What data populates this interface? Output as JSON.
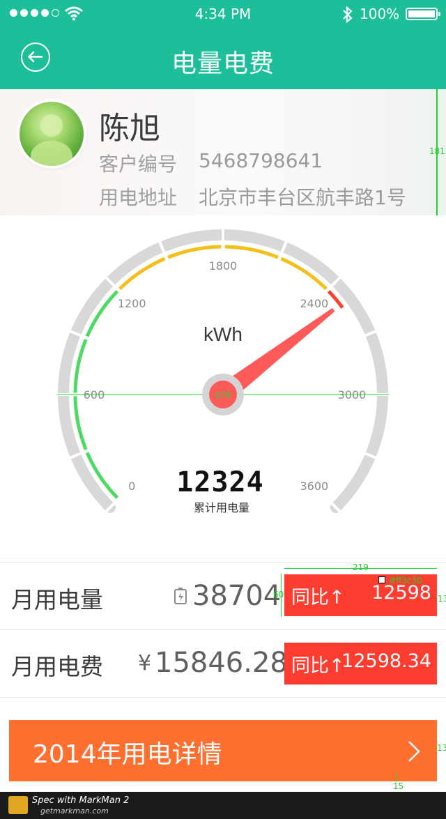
{
  "status_bar": {
    "time": "4:34 PM",
    "battery": "100%"
  },
  "navbar": {
    "title": "电量电费"
  },
  "profile": {
    "name": "陈旭",
    "customer_label": "客户编号",
    "customer_id": "5468798641",
    "address_label": "用电地址",
    "address": "北京市丰台区航丰路1号",
    "ruler_value": "181"
  },
  "gauge": {
    "unit": "kWh",
    "min": 0,
    "max": 3600,
    "major_ticks": [
      "0",
      "600",
      "1200",
      "1800",
      "2400",
      "3000",
      "3600"
    ],
    "needle_value": 2500,
    "center_value": "478",
    "total_value": "12324",
    "total_label": "累计用电量",
    "colors": {
      "green": "#4cd964",
      "yellow": "#f5bf1a",
      "red": "#ff3c30",
      "track": "#d8d8d8",
      "needle": "#ff5a5a"
    }
  },
  "monthly_usage": {
    "label": "月用电量",
    "value": "38704",
    "compare_label": "同比",
    "compare_value": "12598",
    "spec_width": "219",
    "spec_height": "60",
    "spec_color": "#ff3c30",
    "spec_side": "13"
  },
  "monthly_fee": {
    "label": "月用电费",
    "currency": "¥",
    "value": "15846.28",
    "compare_label": "同比",
    "compare_value": "12598.34"
  },
  "cta": {
    "label": "2014年用电详情",
    "spec_right": "13",
    "spec_bottom": "15"
  },
  "footer": {
    "title": "Spec with MarkMan 2",
    "url": "getmarkman.com"
  }
}
